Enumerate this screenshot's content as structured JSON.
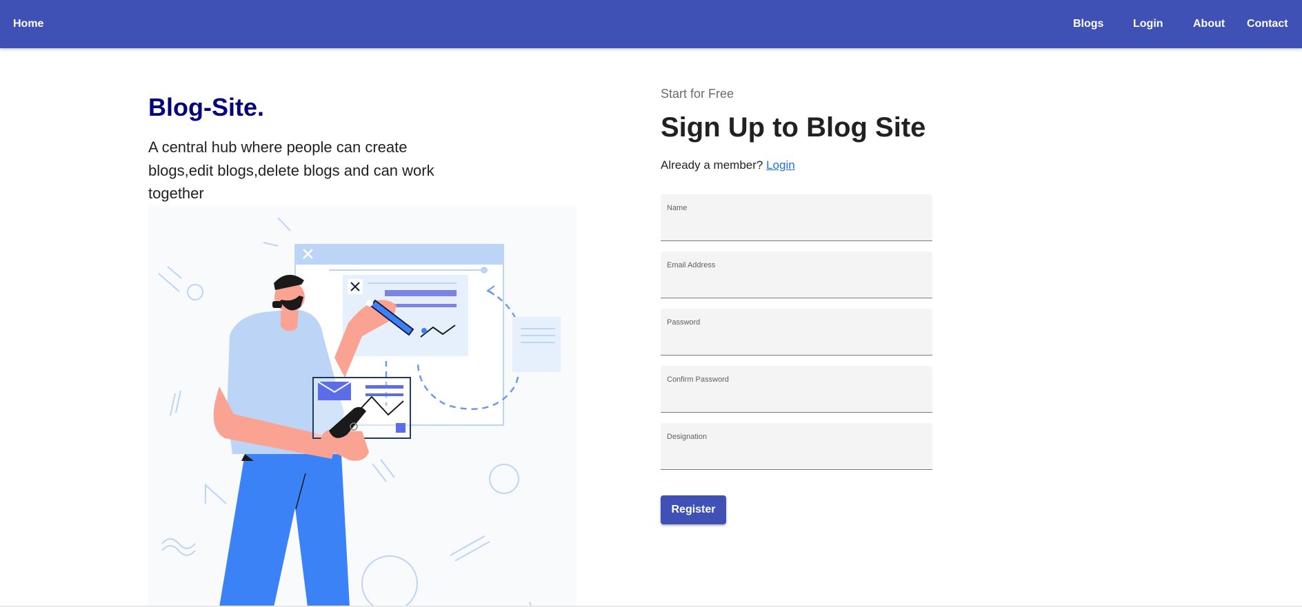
{
  "nav": {
    "home": "Home",
    "blogs": "Blogs",
    "login": "Login",
    "about": "About",
    "contact": "Contact"
  },
  "hero": {
    "brand": "Blog-Site.",
    "tagline": "A central hub where people can create blogs,edit blogs,delete blogs and can work together",
    "illustration_icon": "person-editing-blog-illustration"
  },
  "signup": {
    "overline": "Start for Free",
    "title": "Sign Up to Blog Site",
    "member_text": "Already a member? ",
    "login_link": "Login",
    "fields": [
      {
        "label": "Name",
        "value": ""
      },
      {
        "label": "Email Address",
        "value": ""
      },
      {
        "label": "Password",
        "value": ""
      },
      {
        "label": "Confirm Password",
        "value": ""
      },
      {
        "label": "Designation",
        "value": ""
      }
    ],
    "register_label": "Register"
  },
  "colors": {
    "primary": "#3f51b5",
    "brand_text": "#000080",
    "link": "#1e6fe6",
    "field_bg": "#f4f4f4"
  }
}
